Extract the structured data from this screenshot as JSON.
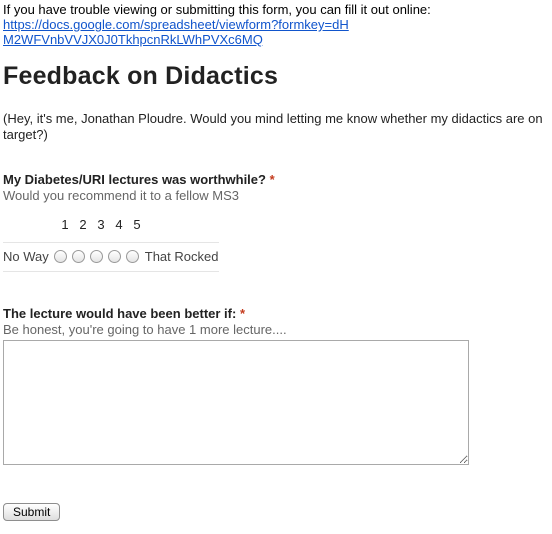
{
  "notice": {
    "text": "If you have trouble viewing or submitting this form, you can fill it out online:",
    "link": "https://docs.google.com/spreadsheet/viewform?formkey=dHM2WFVnbVVJX0J0TkhpcnRkLWhPVXc6MQ"
  },
  "form": {
    "title": "Feedback on Didactics",
    "description": "(Hey, it's me, Jonathan Ploudre. Would you mind letting me know whether my didactics are on target?)"
  },
  "questions": [
    {
      "title": "My Diabetes/URI lectures was worthwhile?",
      "required_mark": "*",
      "help": "Would you recommend it to a fellow MS3",
      "scale_numbers": [
        "1",
        "2",
        "3",
        "4",
        "5"
      ],
      "low_label": "No Way",
      "high_label": "That Rocked"
    },
    {
      "title": "The lecture would have been better if:",
      "required_mark": "*",
      "help": "Be honest, you're going to have 1 more lecture....",
      "value": ""
    }
  ],
  "submit_label": "Submit",
  "colors": {
    "link": "#1155cc",
    "required": "#c43b1d",
    "help_text": "#666666"
  }
}
